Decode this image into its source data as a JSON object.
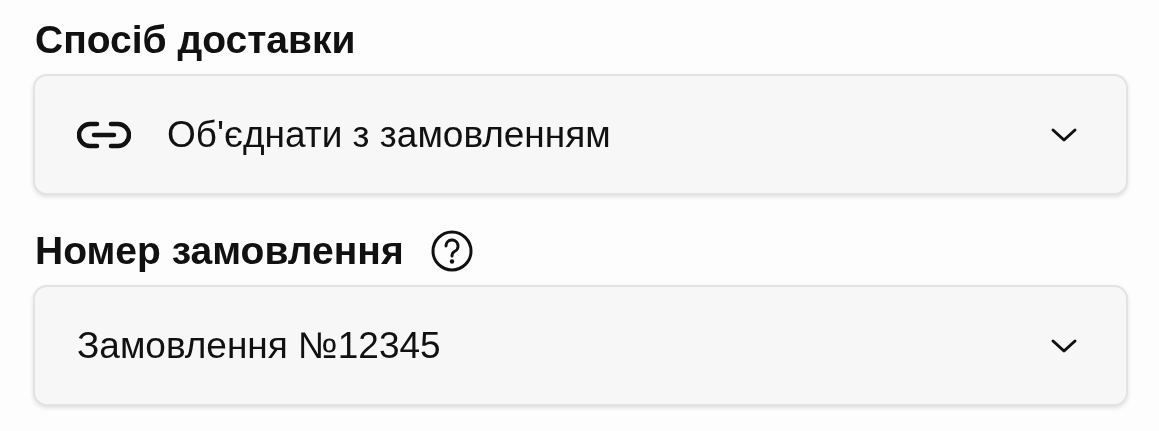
{
  "fields": [
    {
      "label": "Спосіб доставки",
      "help": false,
      "kind": "icon_select",
      "value": "Об'єднати з замовленням"
    },
    {
      "label": "Номер замовлення",
      "help": true,
      "kind": "select",
      "value": "Замовлення №12345"
    }
  ]
}
